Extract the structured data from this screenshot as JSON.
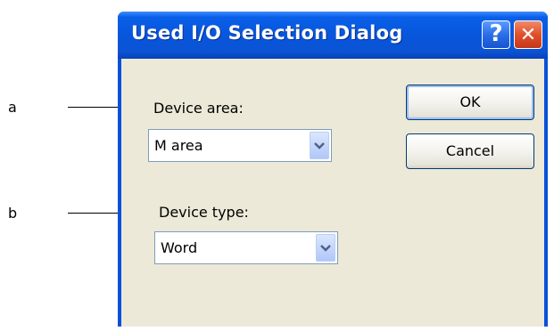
{
  "annotations": {
    "a": "a",
    "b": "b"
  },
  "dialog": {
    "title": "Used I/O Selection Dialog",
    "help_button": "?",
    "close_button": "✕",
    "device_area_label": "Device area:",
    "device_area_value": "M area",
    "device_type_label": "Device type:",
    "device_type_value": "Word",
    "ok_label": "OK",
    "cancel_label": "Cancel"
  },
  "colors": {
    "titlebar": "#0a50d8",
    "client": "#ece9d8",
    "close": "#e0502a"
  }
}
